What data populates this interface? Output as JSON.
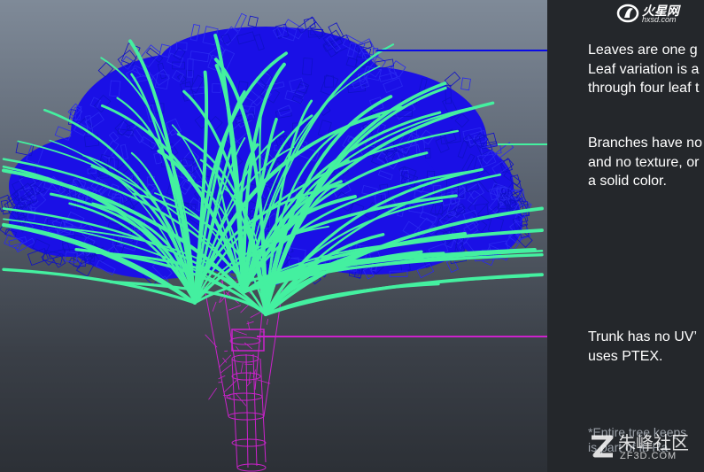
{
  "notes": {
    "leaves": "Leaves are one g\nLeaf variation is a\nthrough four leaf t",
    "branches": "Branches have no\nand no texture, or\na solid color.",
    "trunk": "Trunk has no UV’\nuses PTEX.",
    "tree": "*Entire tree keeps\nis part of it. Ra"
  },
  "watermark_top": {
    "brand": "火星网",
    "url": "hxsd.com"
  },
  "watermark_bottom": {
    "brand": "朱峰社区",
    "url": "ZF3D.COM"
  },
  "colors": {
    "leaves": "#1a10e6",
    "leaf_line": "#0a0ae6",
    "branches": "#44f0a0",
    "trunk": "#cc22cc"
  },
  "icons": [
    "flame-logo-icon",
    "zf-logo-icon"
  ]
}
